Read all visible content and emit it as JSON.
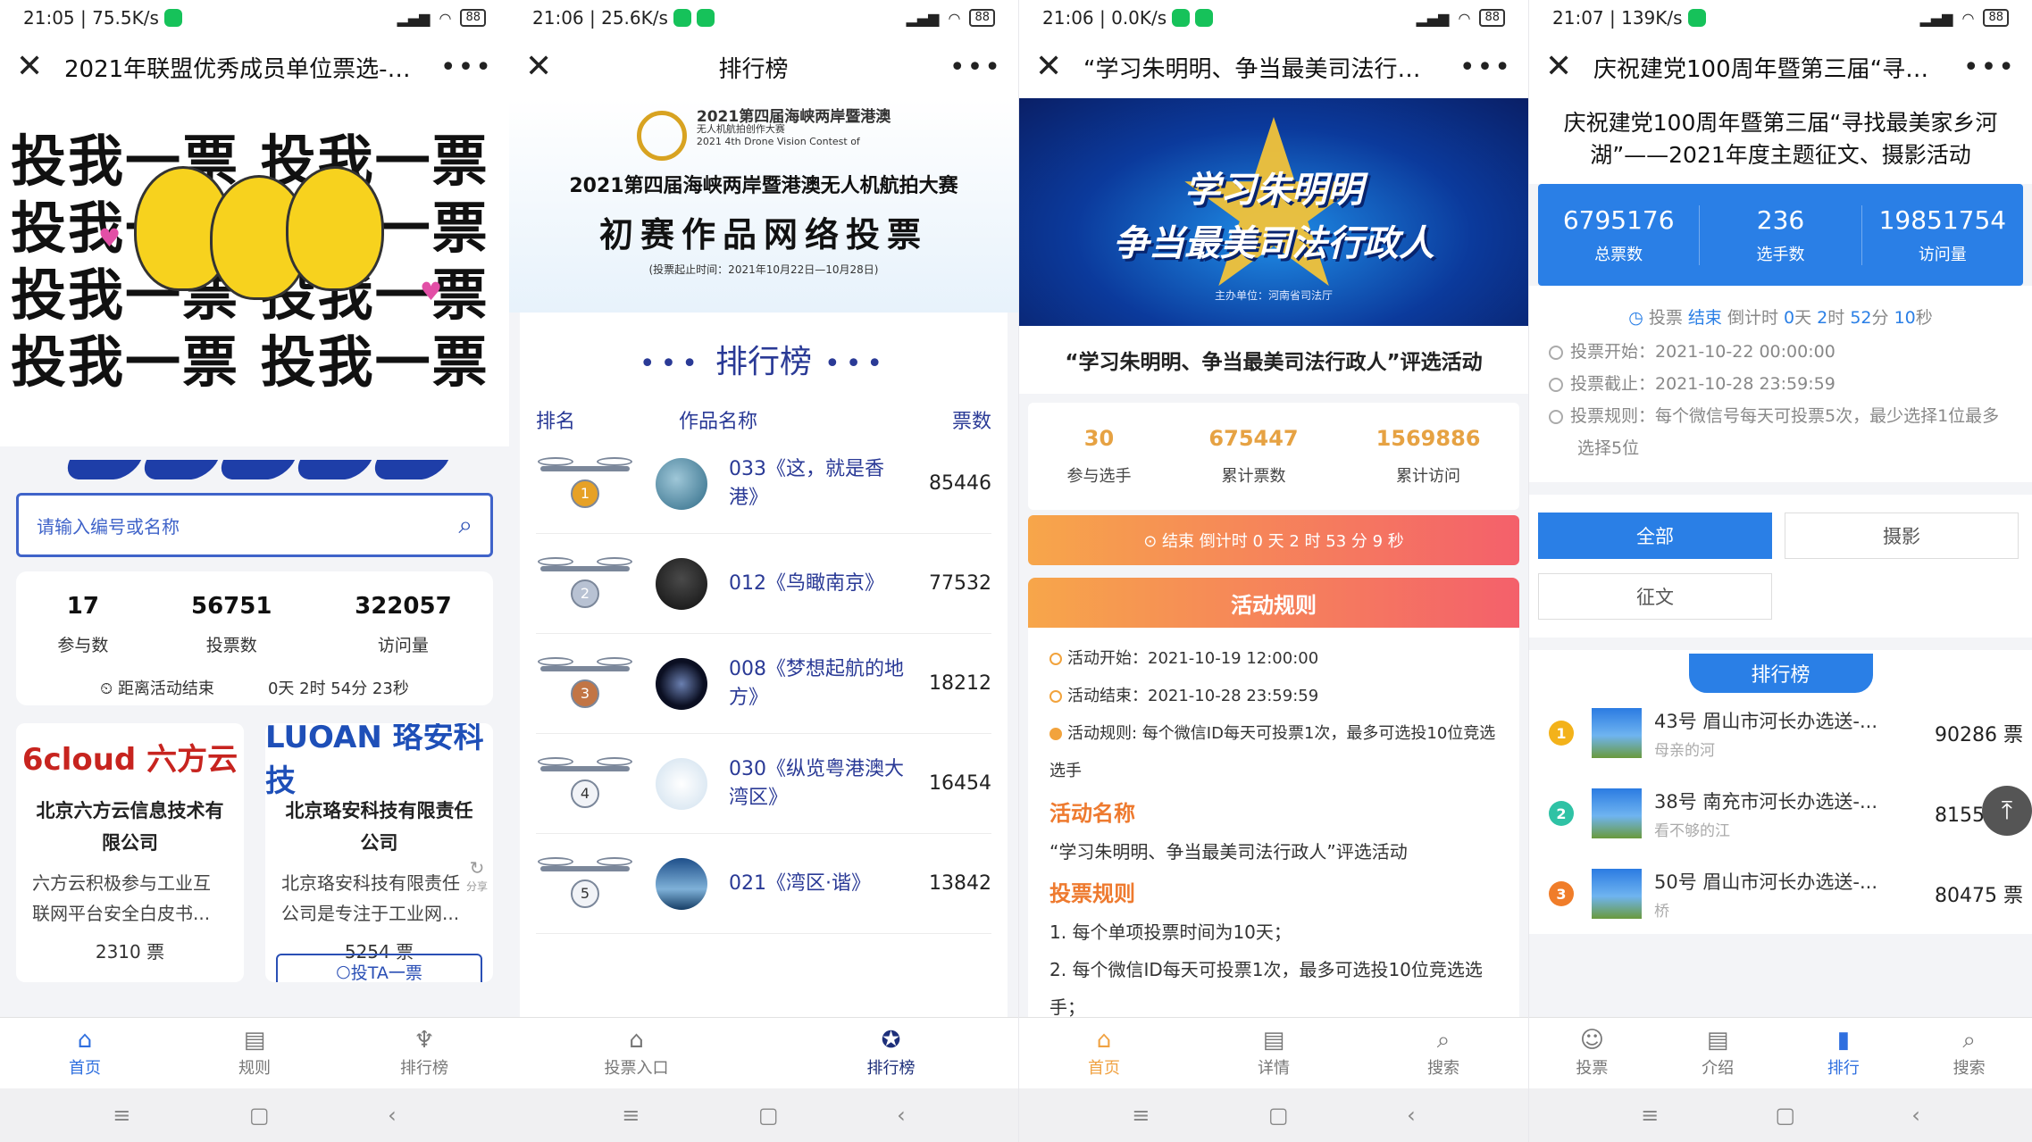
{
  "screens": [
    {
      "status": {
        "time": "21:05 | 75.5K/s",
        "battery": "88"
      },
      "title": "2021年联盟优秀成员单位票选-工...",
      "banner": {
        "line1": "投我一票 投我一票",
        "line2": "投我一票 投我一票",
        "line3": "投我一票 投我一票",
        "line4": "投我一票 投我一票"
      },
      "search": {
        "placeholder": "请输入编号或名称"
      },
      "stats": [
        {
          "value": "17",
          "label": "参与数"
        },
        {
          "value": "56751",
          "label": "投票数"
        },
        {
          "value": "322057",
          "label": "访问量"
        }
      ],
      "countdown": {
        "label": "距离活动结束",
        "value": "0天 2时 54分 23秒"
      },
      "cards": [
        {
          "logo": "6cloud 六方云",
          "title": "北京六方云信息技术有限公司",
          "desc": "六方云积极参与工业互联网平台安全白皮书...",
          "votes": "2310 票"
        },
        {
          "logo": "LUOAN 珞安科技",
          "title": "北京珞安科技有限责任公司",
          "desc": "北京珞安科技有限责任公司是专注于工业网...",
          "votes": "5254 票",
          "vote_button": "投TA一票"
        }
      ],
      "share": "分享",
      "tabs": [
        {
          "icon": "⌂",
          "label": "首页"
        },
        {
          "icon": "▤",
          "label": "规则"
        },
        {
          "icon": "♆",
          "label": "排行榜"
        }
      ]
    },
    {
      "status": {
        "time": "21:06 | 25.6K/s",
        "battery": "88"
      },
      "title": "排行榜",
      "banner": {
        "logo_title": "2021第四届海峡两岸暨港澳",
        "logo_sub": "无人机航拍创作大赛",
        "logo_en": "2021 4th Drone Vision Contest of",
        "heading1": "2021第四届海峡两岸暨港澳无人机航拍大赛",
        "heading2": "初赛作品网络投票",
        "period": "(投票起止时间：2021年10月22日—10月28日)"
      },
      "rank_title": "排行榜",
      "columns": {
        "rank": "排名",
        "name": "作品名称",
        "votes": "票数"
      },
      "rows": [
        {
          "rank": "1",
          "name": "033《这，就是香港》",
          "votes": "85446"
        },
        {
          "rank": "2",
          "name": "012《鸟瞰南京》",
          "votes": "77532"
        },
        {
          "rank": "3",
          "name": "008《梦想起航的地方》",
          "votes": "18212"
        },
        {
          "rank": "4",
          "name": "030《纵览粤港澳大湾区》",
          "votes": "16454"
        },
        {
          "rank": "5",
          "name": "021《湾区·谐》",
          "votes": "13842"
        }
      ],
      "tabs": [
        {
          "icon": "⌂",
          "label": "投票入口"
        },
        {
          "icon": "✪",
          "label": "排行榜"
        }
      ]
    },
    {
      "status": {
        "time": "21:06 | 0.0K/s",
        "battery": "88"
      },
      "title": "“学习朱明明、争当最美司法行政人...",
      "banner": {
        "line1": "学习朱明明",
        "line2": "争当最美司法行政人",
        "organizer": "主办单位：河南省司法厅"
      },
      "activity_title": "“学习朱明明、争当最美司法行政人”评选活动",
      "stats": [
        {
          "value": "30",
          "label": "参与选手"
        },
        {
          "value": "675447",
          "label": "累计票数"
        },
        {
          "value": "1569886",
          "label": "累计访问"
        }
      ],
      "countdown": "⊙ 结束 倒计时 0 天 2 时 53 分 9 秒",
      "rules_title": "活动规则",
      "rules": {
        "start": "活动开始：2021-10-19 12:00:00",
        "end": "活动结束：2021-10-28 23:59:59",
        "rule": "活动规则: 每个微信ID每天可投票1次，最多可选投10位竞选选手",
        "sec1": "活动名称",
        "name": "“学习朱明明、争当最美司法行政人”评选活动",
        "sec2": "投票规则",
        "r1": "1. 每个单项投票时间为10天；",
        "r2": "2. 每个微信ID每天可投票1次，最多可选投10位竞选选手；"
      },
      "tabs": [
        {
          "icon": "⌂",
          "label": "首页"
        },
        {
          "icon": "▤",
          "label": "详情"
        },
        {
          "icon": "⌕",
          "label": "搜索"
        }
      ]
    },
    {
      "status": {
        "time": "21:07 | 139K/s",
        "battery": "88"
      },
      "title": "庆祝建党100周年暨第三届“寻找最...",
      "headline": "庆祝建党100周年暨第三届“寻找最美家乡河湖”——2021年度主题征文、摄影活动",
      "stats": [
        {
          "value": "6795176",
          "label": "总票数"
        },
        {
          "value": "236",
          "label": "选手数"
        },
        {
          "value": "19851754",
          "label": "访问量"
        }
      ],
      "countdown": {
        "prefix": "投票",
        "status": "结束",
        "mid": "倒计时",
        "d": "0",
        "h": "2",
        "m": "52",
        "s": "10",
        "u_d": "天",
        "u_h": "时",
        "u_m": "分",
        "u_s": "秒"
      },
      "start": "投票开始：2021-10-22 00:00:00",
      "end": "投票截止：2021-10-28 23:59:59",
      "rule": "投票规则：每个微信号每天可投票5次，最少选择1位最多选择5位",
      "filters": [
        "全部",
        "摄影",
        "征文"
      ],
      "rank_title": "排行榜",
      "rows": [
        {
          "medal": "1",
          "name": "43号 眉山市河长办选送-...",
          "sub": "母亲的河",
          "votes": "90286 票"
        },
        {
          "medal": "2",
          "name": "38号 南充市河长办选送-...",
          "sub": "看不够的江",
          "votes": "81556 票"
        },
        {
          "medal": "3",
          "name": "50号 眉山市河长办选送-...",
          "sub": "桥",
          "votes": "80475 票"
        }
      ],
      "tabs": [
        {
          "icon": "☺",
          "label": "投票"
        },
        {
          "icon": "▤",
          "label": "介绍"
        },
        {
          "icon": "▮",
          "label": "排行"
        },
        {
          "icon": "⌕",
          "label": "搜索"
        }
      ]
    }
  ],
  "nav": {
    "menu": "≡",
    "home": "▢",
    "back": "‹"
  }
}
